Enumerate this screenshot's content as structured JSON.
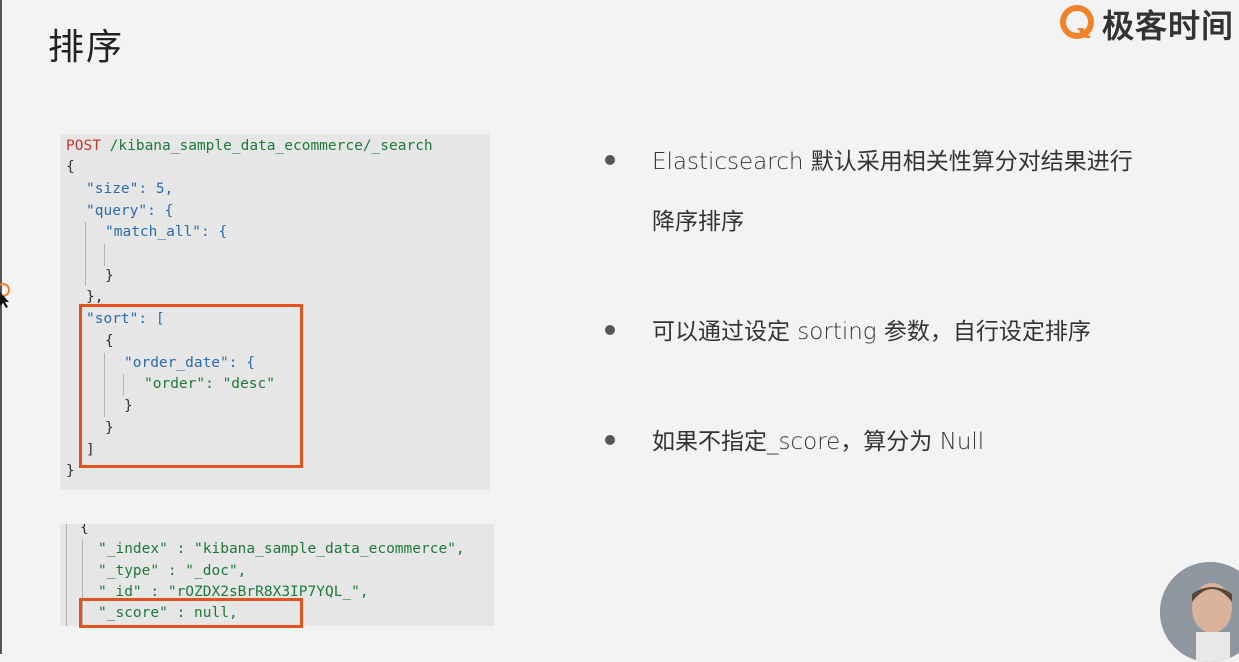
{
  "slide": {
    "title": "排序",
    "brand": "极客时间"
  },
  "request_code": {
    "method": "POST",
    "path": "/kibana_sample_data_ecommerce/_search",
    "lines": [
      "{",
      "\"size\": 5,",
      "\"query\": {",
      "\"match_all\": {",
      "}",
      "},",
      "\"sort\": [",
      "{",
      "\"order_date\": {",
      "\"order\": \"desc\"",
      "}",
      "}",
      "]",
      "}"
    ]
  },
  "response_code": {
    "lines": [
      "{",
      "\"_index\" : \"kibana_sample_data_ecommerce\",",
      "\"_type\" : \"_doc\",",
      "\"_id\" : \"rOZDX2sBrR8X3IP7YQL_\",",
      "\"_score\" : null,"
    ]
  },
  "bullets": [
    "Elasticsearch 默认采用相关性算分对结果进行",
    "降序排序",
    "可以通过设定 sorting 参数，自行设定排序",
    "如果不指定_score，算分为 Null"
  ],
  "colors": {
    "highlight": "#e3531e",
    "code_bg": "#e6e6e6",
    "slide_bg": "#f3f3f3",
    "string": "#1e7a3a",
    "key": "#2a6cb0",
    "method": "#c0392b"
  },
  "icons": [
    "geektime-logo-icon",
    "mouse-cursor-icon",
    "bullet-dot-icon",
    "presenter-avatar"
  ]
}
